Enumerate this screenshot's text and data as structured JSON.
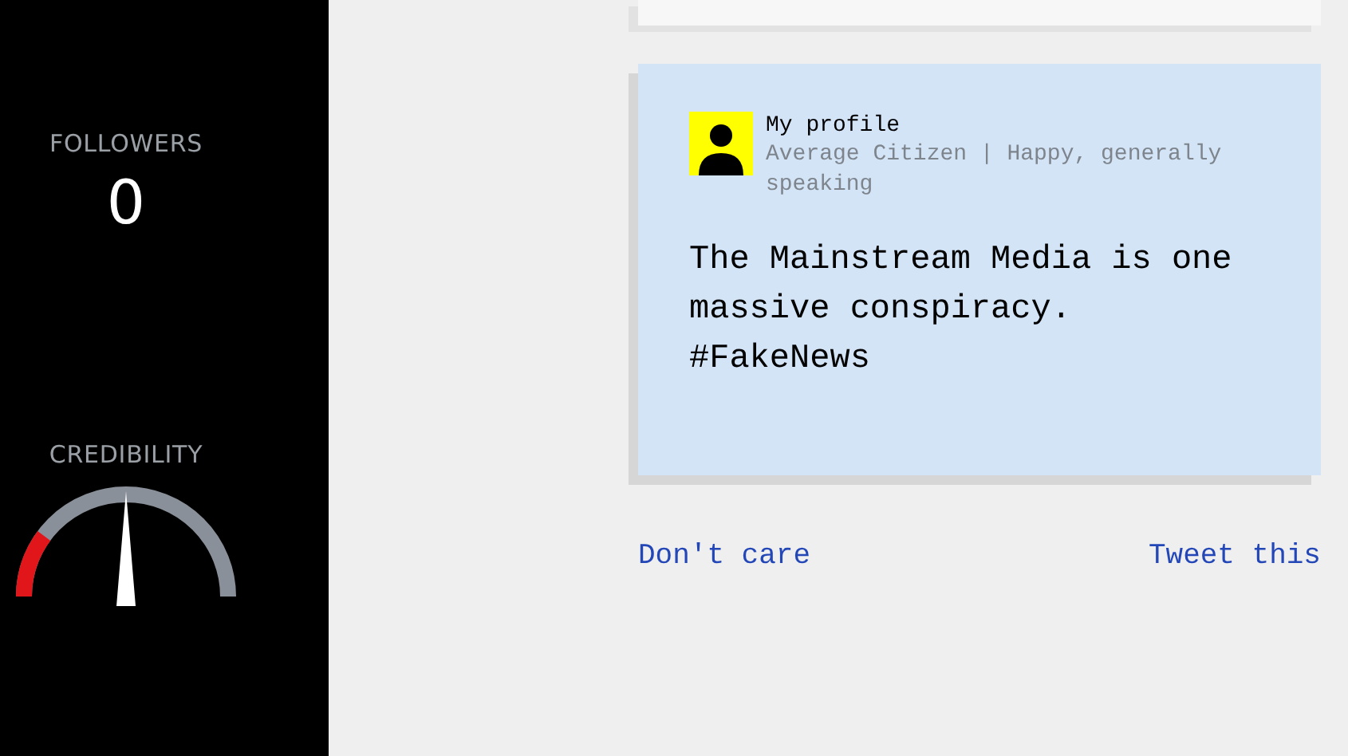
{
  "sidebar": {
    "followers": {
      "label": "FOLLOWERS",
      "value": "0"
    },
    "credibility": {
      "label": "CREDIBILITY"
    }
  },
  "tweet": {
    "author": "My profile",
    "bio": "Average Citizen | Happy, generally speaking",
    "text": "The Mainstream Media is one massive conspiracy. #FakeNews"
  },
  "actions": [
    "Don't care",
    "Tweet this"
  ]
}
